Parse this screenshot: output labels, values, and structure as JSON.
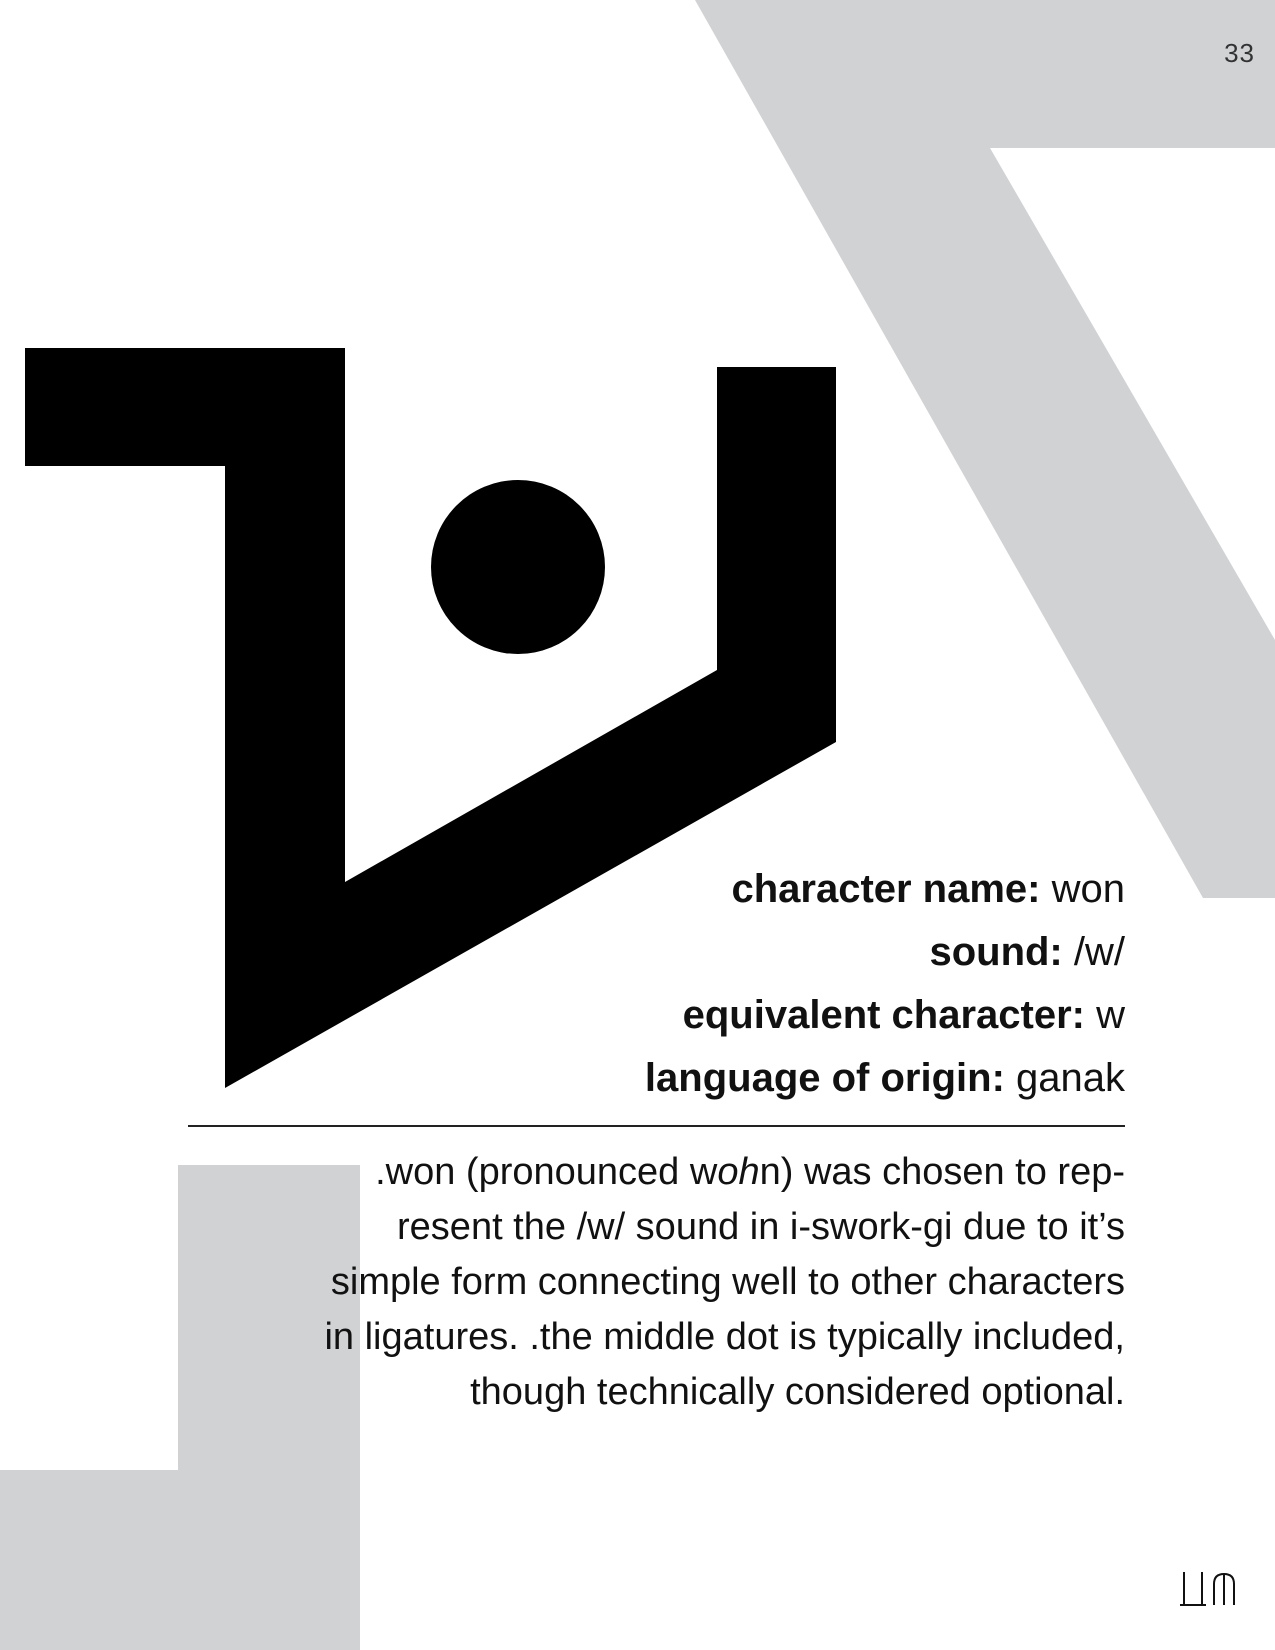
{
  "page": {
    "number": "33"
  },
  "character": {
    "fields": [
      {
        "key": "character name:",
        "value": " won"
      },
      {
        "key": "sound:",
        "value": " /w/"
      },
      {
        "key": "equivalent character:",
        "value": " w"
      },
      {
        "key": "language of origin:",
        "value": " ganak"
      }
    ]
  },
  "description": {
    "lines": [
      {
        "pre": ".won (pronounced w",
        "em": "oh",
        "post": "n) was chosen to rep-"
      },
      {
        "text": "resent the /w/ sound in i-swork-gi due to it’s"
      },
      {
        "text": "simple form connecting well to other characters"
      },
      {
        "text": "in ligatures. .the middle dot is typically included,"
      },
      {
        "text": "though technically considered optional."
      }
    ]
  },
  "colors": {
    "background": "#ffffff",
    "accent_gray": "#d1d2d4",
    "ink": "#000000"
  },
  "icons": {
    "glyph": "won-glyph-icon",
    "corner": "corner-mark-icon"
  }
}
